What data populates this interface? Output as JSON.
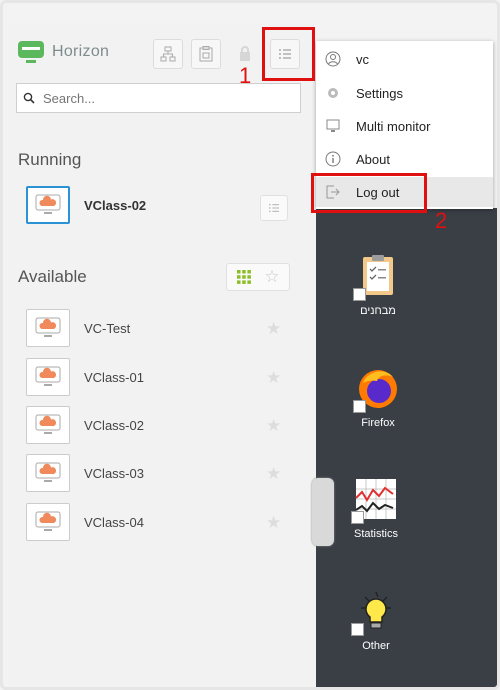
{
  "app": {
    "name": "Horizon"
  },
  "search": {
    "placeholder": "Search..."
  },
  "sections": {
    "running": "Running",
    "available": "Available"
  },
  "running": [
    {
      "label": "VClass-02"
    }
  ],
  "available": [
    {
      "label": "VC-Test"
    },
    {
      "label": "VClass-01"
    },
    {
      "label": "VClass-02"
    },
    {
      "label": "VClass-03"
    },
    {
      "label": "VClass-04"
    }
  ],
  "menu": {
    "user": "vc",
    "settings": "Settings",
    "multi_monitor": "Multi monitor",
    "about": "About",
    "logout": "Log out"
  },
  "callouts": {
    "one": "1",
    "two": "2"
  },
  "desktop": {
    "icons": [
      {
        "label": "מבחנים"
      },
      {
        "label": "Firefox"
      },
      {
        "label": "Statistics"
      },
      {
        "label": "Other"
      }
    ]
  },
  "colors": {
    "accent": "#2a93d5",
    "callout": "#e01010",
    "logo_green": "#5cb85c",
    "vm_orange": "#f08a5d"
  }
}
